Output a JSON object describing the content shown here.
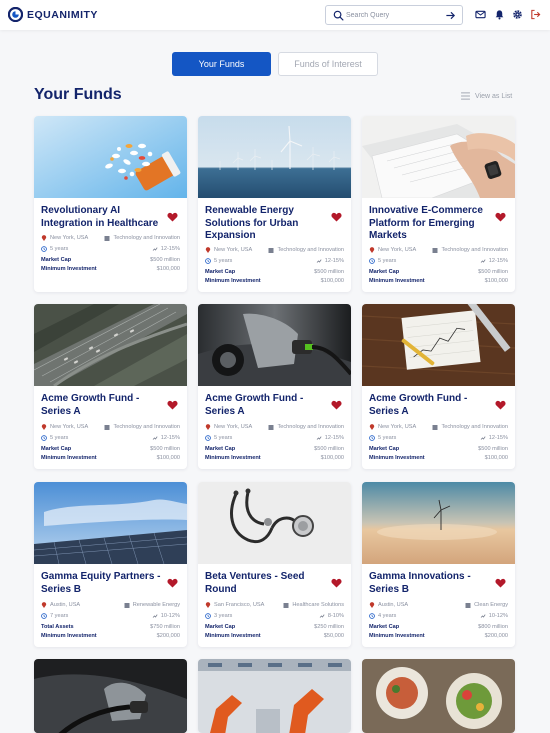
{
  "header": {
    "brand": "EQUANIMITY",
    "search_placeholder": "Search Query"
  },
  "tabs": [
    {
      "label": "Your Funds",
      "active": true
    },
    {
      "label": "Funds of Interest",
      "active": false
    }
  ],
  "section": {
    "title": "Your Funds",
    "view_toggle": "View as List"
  },
  "colors": {
    "brand": "#13246b",
    "accent": "#1456c4",
    "heart": "#b3192a"
  },
  "cards": [
    {
      "title": "Revolutionary AI Integration in Healthcare",
      "location": "New York, USA",
      "sector": "Technology and Innovation",
      "term": "5 years",
      "return": "12-15%",
      "m1_label": "Market Cap",
      "m1_value": "$500 million",
      "m2_label": "Minimum Investment",
      "m2_value": "$100,000",
      "image": "pills"
    },
    {
      "title": "Renewable Energy Solutions for Urban Expansion",
      "location": "New York, USA",
      "sector": "Technology and Innovation",
      "term": "5 years",
      "return": "12-15%",
      "m1_label": "Market Cap",
      "m1_value": "$500 million",
      "m2_label": "Minimum Investment",
      "m2_value": "$100,000",
      "image": "wind-farm"
    },
    {
      "title": "Innovative E-Commerce Platform for Emerging Markets",
      "location": "New York, USA",
      "sector": "Technology and Innovation",
      "term": "5 years",
      "return": "12-15%",
      "m1_label": "Market Cap",
      "m1_value": "$500 million",
      "m2_label": "Minimum Investment",
      "m2_value": "$100,000",
      "image": "laptop"
    },
    {
      "title": "Acme Growth Fund - Series A",
      "location": "New York, USA",
      "sector": "Technology and Innovation",
      "term": "5 years",
      "return": "12-15%",
      "m1_label": "Market Cap",
      "m1_value": "$500 million",
      "m2_label": "Minimum Investment",
      "m2_value": "$100,000",
      "image": "highway"
    },
    {
      "title": "Acme Growth Fund - Series A",
      "location": "New York, USA",
      "sector": "Technology and Innovation",
      "term": "5 years",
      "return": "12-15%",
      "m1_label": "Market Cap",
      "m1_value": "$500 million",
      "m2_label": "Minimum Investment",
      "m2_value": "$100,000",
      "image": "ev-charger"
    },
    {
      "title": "Acme Growth Fund - Series A",
      "location": "New York, USA",
      "sector": "Technology and Innovation",
      "term": "5 years",
      "return": "12-15%",
      "m1_label": "Market Cap",
      "m1_value": "$500 million",
      "m2_label": "Minimum Investment",
      "m2_value": "$100,000",
      "image": "chart-desk"
    },
    {
      "title": "Gamma Equity Partners - Series B",
      "location": "Austin, USA",
      "sector": "Renewable Energy",
      "term": "7 years",
      "return": "10-12%",
      "m1_label": "Total Assets",
      "m1_value": "$750 million",
      "m2_label": "Minimum Investment",
      "m2_value": "$200,000",
      "image": "solar"
    },
    {
      "title": "Beta Ventures - Seed Round",
      "location": "San Francisco, USA",
      "sector": "Healthcare Solutions",
      "term": "3 years",
      "return": "8-10%",
      "m1_label": "Market Cap",
      "m1_value": "$250 million",
      "m2_label": "Minimum Investment",
      "m2_value": "$50,000",
      "image": "stethoscope"
    },
    {
      "title": "Gamma Innovations - Series B",
      "location": "Austin, USA",
      "sector": "Clean Energy",
      "term": "4 years",
      "return": "10-12%",
      "m1_label": "Market Cap",
      "m1_value": "$800 million",
      "m2_label": "Minimum Investment",
      "m2_value": "$200,000",
      "image": "turbine-sunset"
    },
    {
      "title": "",
      "image": "ev-plug"
    },
    {
      "title": "",
      "image": "robots"
    },
    {
      "title": "",
      "image": "food"
    }
  ]
}
